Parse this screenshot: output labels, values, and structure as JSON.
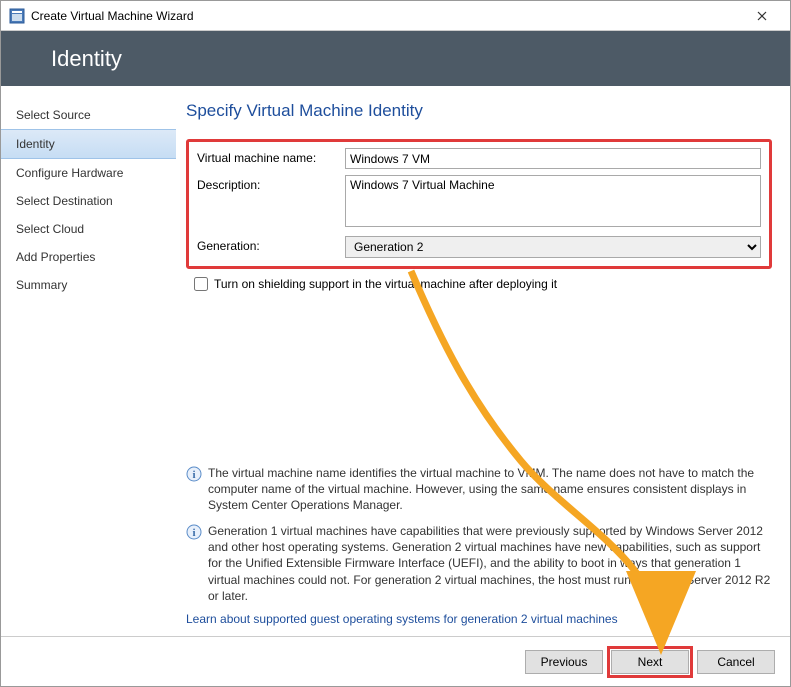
{
  "window": {
    "title": "Create Virtual Machine Wizard"
  },
  "header": {
    "title": "Identity"
  },
  "sidebar": {
    "items": [
      {
        "label": "Select Source"
      },
      {
        "label": "Identity"
      },
      {
        "label": "Configure Hardware"
      },
      {
        "label": "Select Destination"
      },
      {
        "label": "Select Cloud"
      },
      {
        "label": "Add Properties"
      },
      {
        "label": "Summary"
      }
    ]
  },
  "main": {
    "heading": "Specify Virtual Machine Identity",
    "fields": {
      "vm_name_label": "Virtual machine name:",
      "vm_name_value": "Windows 7 VM",
      "description_label": "Description:",
      "description_value": "Windows 7 Virtual Machine",
      "generation_label": "Generation:",
      "generation_value": "Generation 2"
    },
    "checkbox": {
      "label": "Turn on shielding support in the virtual machine after deploying it"
    },
    "info1": "The virtual machine name identifies the virtual machine to VMM. The name does not have to match the computer name of the virtual machine. However, using the same name ensures consistent displays in System Center Operations Manager.",
    "info2": "Generation 1 virtual machines have capabilities that were previously supported by Windows Server 2012 and other host operating systems. Generation 2 virtual machines have new capabilities, such as support for the Unified Extensible Firmware Interface (UEFI), and the ability to boot in ways that generation 1 virtual machines could not. For generation 2 virtual machines, the host must run Windows Server 2012 R2 or later.",
    "link": "Learn about supported guest operating systems for generation 2 virtual machines"
  },
  "footer": {
    "previous": "Previous",
    "next": "Next",
    "cancel": "Cancel"
  }
}
